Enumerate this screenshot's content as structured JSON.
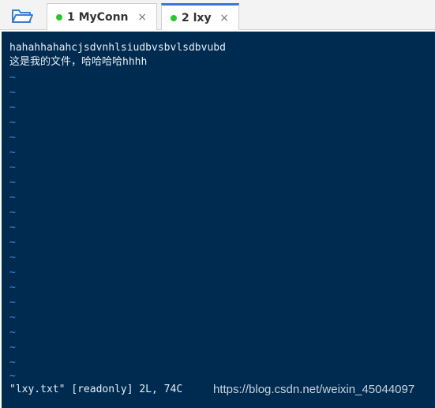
{
  "tabs": [
    {
      "label": "1 MyConn",
      "status_color": "#2cc62c",
      "close": "×"
    },
    {
      "label": "2 lxy",
      "status_color": "#2cc62c",
      "close": "×"
    }
  ],
  "terminal": {
    "lines": [
      "hahahhahahcjsdvnhlsiudbvsbvlsdbvubd",
      "这是我的文件，哈哈哈哈hhhh"
    ],
    "empty_line_marker": "~",
    "status_line": "\"lxy.txt\" [readonly] 2L, 74C"
  },
  "watermark": "https://blog.csdn.net/weixin_45044097"
}
